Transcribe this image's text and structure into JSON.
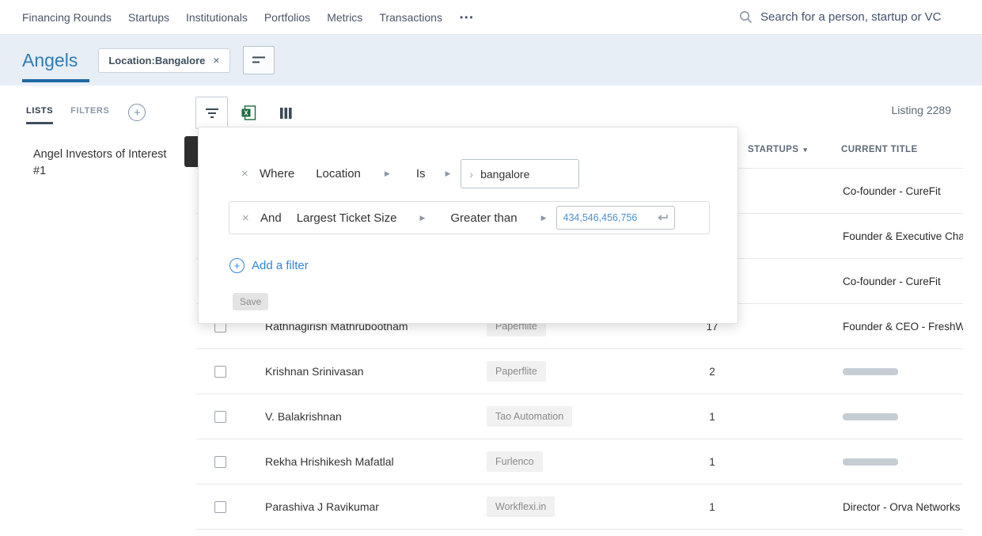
{
  "icons": {
    "close": "×",
    "caret_right": "▶",
    "chevron_right": "›",
    "plus": "+",
    "sort_caret": "▾",
    "more": "•••"
  },
  "top_nav": {
    "items": [
      "Financing Rounds",
      "Startups",
      "Institutionals",
      "Portfolios",
      "Metrics",
      "Transactions"
    ],
    "search_placeholder": "Search for a person, startup or VC"
  },
  "page_header": {
    "title": "Angels",
    "chip_label": "Location:Bangalore"
  },
  "sidebar": {
    "tab_lists": "LISTS",
    "tab_filters": "FILTERS",
    "list_item": "Angel Investors of Interest #1"
  },
  "toolbar": {
    "listing_text": "Listing 2289"
  },
  "filter_panel": {
    "row1": {
      "connector": "Where",
      "field": "Location",
      "operator": "Is",
      "value": "bangalore"
    },
    "row2": {
      "connector": "And",
      "field": "Largest Ticket Size",
      "operator": "Greater than",
      "value": "434,546,456,756"
    },
    "add_filter_label": "Add a filter",
    "save_label": "Save"
  },
  "table": {
    "header_startups": "STARTUPS",
    "header_current_title": "CURRENT TITLE",
    "rows": [
      {
        "name": "",
        "company": "",
        "count": "",
        "title": "Co-founder - CureFit",
        "redacted": false
      },
      {
        "name": "",
        "company": "",
        "count": "",
        "title": "Founder & Executive Cha",
        "redacted": false
      },
      {
        "name": "",
        "company": "",
        "count": "",
        "title": "Co-founder - CureFit",
        "redacted": false
      },
      {
        "name": "Rathnagirish Mathrubootham",
        "company": "Paperflite",
        "count": "17",
        "title": "Founder & CEO - FreshW",
        "redacted": false
      },
      {
        "name": "Krishnan Srinivasan",
        "company": "Paperflite",
        "count": "2",
        "title": "",
        "redacted": true
      },
      {
        "name": "V. Balakrishnan",
        "company": "Tao Automation",
        "count": "1",
        "title": "",
        "redacted": true
      },
      {
        "name": "Rekha Hrishikesh Mafatlal",
        "company": "Furlenco",
        "count": "1",
        "title": "",
        "redacted": true
      },
      {
        "name": "Parashiva J Ravikumar",
        "company": "Workflexi.in",
        "count": "1",
        "title": "Director - Orva Networks",
        "redacted": false
      }
    ]
  }
}
